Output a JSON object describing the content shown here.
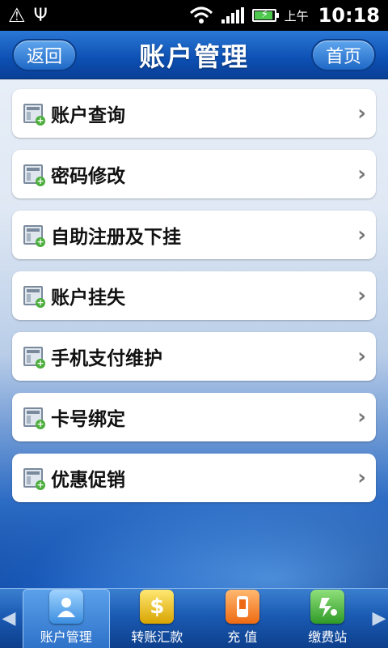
{
  "status_bar": {
    "ampm": "上午",
    "time": "10:18",
    "icons": [
      "warning-icon",
      "usb-icon",
      "wifi-icon",
      "signal-icon",
      "battery-charging-icon"
    ]
  },
  "header": {
    "back_label": "返回",
    "title": "账户管理",
    "home_label": "首页"
  },
  "menu": {
    "items": [
      {
        "label": "账户查询",
        "icon": "form-add-icon"
      },
      {
        "label": "密码修改",
        "icon": "form-add-icon"
      },
      {
        "label": "自助注册及下挂",
        "icon": "form-add-icon"
      },
      {
        "label": "账户挂失",
        "icon": "form-add-icon"
      },
      {
        "label": "手机支付维护",
        "icon": "form-add-icon"
      },
      {
        "label": "卡号绑定",
        "icon": "form-add-icon"
      },
      {
        "label": "优惠促销",
        "icon": "form-add-icon"
      }
    ],
    "arrow": "›"
  },
  "tabbar": {
    "left_arrow": "◀",
    "right_arrow": "▶",
    "tabs": [
      {
        "label": "账户管理",
        "icon": "account-icon",
        "active": true
      },
      {
        "label": "转账汇款",
        "icon": "transfer-icon",
        "active": false
      },
      {
        "label": "充 值",
        "icon": "recharge-icon",
        "active": false
      },
      {
        "label": "缴费站",
        "icon": "payment-icon",
        "active": false
      }
    ]
  },
  "colors": {
    "header_blue": "#0c4fb2",
    "tab_blue": "#1b5bb4",
    "item_bg": "#ffffff"
  }
}
